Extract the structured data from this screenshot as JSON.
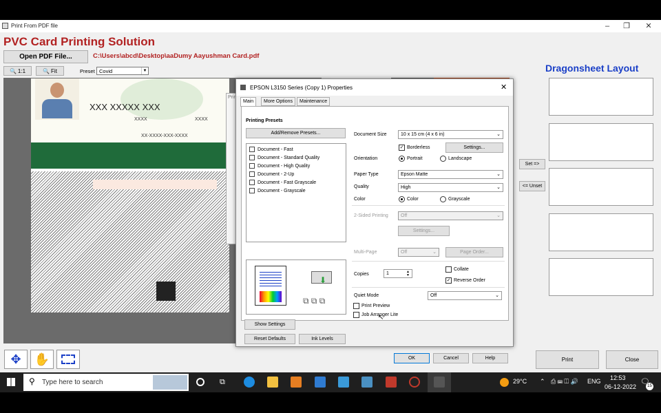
{
  "window": {
    "title": "Print From PDF file"
  },
  "app": {
    "title": "PVC Card Printing Solution",
    "open_button": "Open PDF File...",
    "file_path": "C:\\Users\\abcd\\Desktop\\aaDumy Aayushman Card.pdf",
    "zoom_1to1": "1:1",
    "zoom_fit": "Fit",
    "preset_label": "Preset",
    "preset_value": "Covid",
    "layout_title": "Dragonsheet Layout",
    "set_button": "Set =>",
    "unset_button": "<= Unset",
    "print_button": "Print",
    "close_button": "Close"
  },
  "card": {
    "name": "XXX XXXXX XXX",
    "field_dob": "XXXX",
    "field_gender": "XXXX",
    "field_id": "XX-XXXX-XXX-XXXX"
  },
  "dialog": {
    "title": "EPSON L3150 Series (Copy 1) Properties",
    "tabs": [
      "Main",
      "More Options",
      "Maintenance"
    ],
    "printing_presets_label": "Printing Presets",
    "add_remove_presets": "Add/Remove Presets...",
    "presets": [
      "Document - Fast",
      "Document - Standard Quality",
      "Document - High Quality",
      "Document - 2-Up",
      "Document - Fast Grayscale",
      "Document - Grayscale"
    ],
    "document_size_label": "Document Size",
    "document_size_value": "10 x 15 cm (4 x 6 in)",
    "borderless_label": "Borderless",
    "settings_button": "Settings...",
    "orientation_label": "Orientation",
    "portrait_label": "Portrait",
    "landscape_label": "Landscape",
    "paper_type_label": "Paper Type",
    "paper_type_value": "Epson Matte",
    "quality_label": "Quality",
    "quality_value": "High",
    "color_label": "Color",
    "color_option": "Color",
    "grayscale_option": "Grayscale",
    "two_sided_label": "2-Sided Printing",
    "two_sided_value": "Off",
    "two_sided_settings": "Settings...",
    "multipage_label": "Multi-Page",
    "multipage_value": "Off",
    "page_order_button": "Page Order...",
    "copies_label": "Copies",
    "copies_value": "1",
    "collate_label": "Collate",
    "reverse_order_label": "Reverse Order",
    "quiet_mode_label": "Quiet Mode",
    "quiet_mode_value": "Off",
    "print_preview_label": "Print Preview",
    "job_arranger_label": "Job Arranger Lite",
    "show_settings": "Show Settings",
    "reset_defaults": "Reset Defaults",
    "ink_levels": "Ink Levels",
    "ok": "OK",
    "cancel": "Cancel",
    "help": "Help"
  },
  "taskbar": {
    "search_placeholder": "Type here to search",
    "temperature": "29°C",
    "language": "ENG",
    "time": "12:53",
    "date": "06-12-2022",
    "notification_count": "15"
  }
}
